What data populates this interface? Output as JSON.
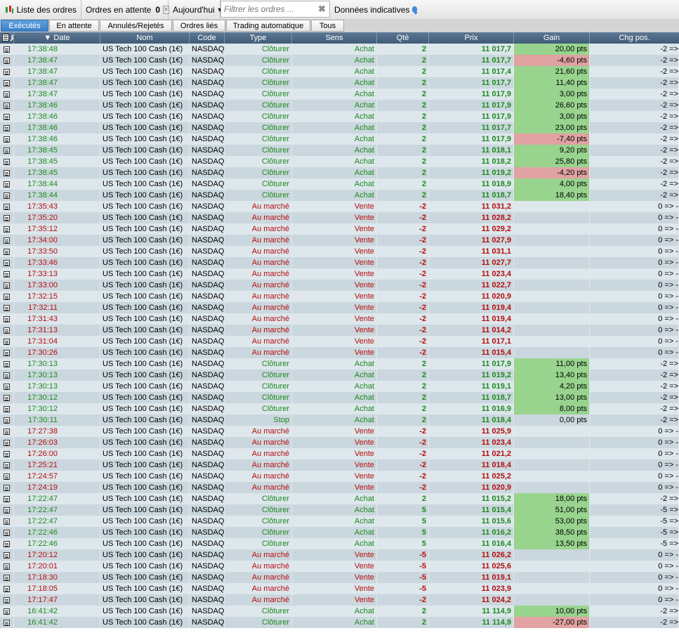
{
  "toolbar": {
    "order_list": "Liste des ordres",
    "pending_label": "Ordres en attente",
    "pending_count": "0",
    "period": "Aujourd'hui",
    "filter_placeholder": "Filtrer les ordres ...",
    "indicative": "Données indicatives"
  },
  "tabs": [
    "Exécutés",
    "En attente",
    "Annulés/Rejetés",
    "Ordres liés",
    "Trading automatique",
    "Tous"
  ],
  "active_tab": "Exécutés",
  "columns": [
    "Date",
    "Nom",
    "Code",
    "Type",
    "Sens",
    "Qté",
    "Prix",
    "Gain",
    "Chg pos."
  ],
  "sorted_column": "Date",
  "colors": {
    "buy": "#1d8a1d",
    "sell": "#b50d0d",
    "gain_positive": "#98d48e",
    "gain_negative": "#e1a2a2",
    "header": "#4a6683",
    "active_tab": "#3c7fc6"
  },
  "rows": [
    [
      "17:38:48",
      "US Tech 100 Cash (1€)",
      "NASDAQ",
      "Clôturer",
      "Achat",
      "2",
      "11 017,7",
      "20,00 pts",
      "-2 =>"
    ],
    [
      "17:38:47",
      "US Tech 100 Cash (1€)",
      "NASDAQ",
      "Clôturer",
      "Achat",
      "2",
      "11 017,7",
      "-4,60 pts",
      "-2 =>"
    ],
    [
      "17:38:47",
      "US Tech 100 Cash (1€)",
      "NASDAQ",
      "Clôturer",
      "Achat",
      "2",
      "11 017,4",
      "21,60 pts",
      "-2 =>"
    ],
    [
      "17:38:47",
      "US Tech 100 Cash (1€)",
      "NASDAQ",
      "Clôturer",
      "Achat",
      "2",
      "11 017,7",
      "11,40 pts",
      "-2 =>"
    ],
    [
      "17:38:47",
      "US Tech 100 Cash (1€)",
      "NASDAQ",
      "Clôturer",
      "Achat",
      "2",
      "11 017,9",
      "3,00 pts",
      "-2 =>"
    ],
    [
      "17:38:46",
      "US Tech 100 Cash (1€)",
      "NASDAQ",
      "Clôturer",
      "Achat",
      "2",
      "11 017,9",
      "26,60 pts",
      "-2 =>"
    ],
    [
      "17:38:46",
      "US Tech 100 Cash (1€)",
      "NASDAQ",
      "Clôturer",
      "Achat",
      "2",
      "11 017,9",
      "3,00 pts",
      "-2 =>"
    ],
    [
      "17:38:46",
      "US Tech 100 Cash (1€)",
      "NASDAQ",
      "Clôturer",
      "Achat",
      "2",
      "11 017,7",
      "23,00 pts",
      "-2 =>"
    ],
    [
      "17:38:46",
      "US Tech 100 Cash (1€)",
      "NASDAQ",
      "Clôturer",
      "Achat",
      "2",
      "11 017,9",
      "-7,40 pts",
      "-2 =>"
    ],
    [
      "17:38:45",
      "US Tech 100 Cash (1€)",
      "NASDAQ",
      "Clôturer",
      "Achat",
      "2",
      "11 018,1",
      "9,20 pts",
      "-2 =>"
    ],
    [
      "17:38:45",
      "US Tech 100 Cash (1€)",
      "NASDAQ",
      "Clôturer",
      "Achat",
      "2",
      "11 018,2",
      "25,80 pts",
      "-2 =>"
    ],
    [
      "17:38:45",
      "US Tech 100 Cash (1€)",
      "NASDAQ",
      "Clôturer",
      "Achat",
      "2",
      "11 019,2",
      "-4,20 pts",
      "-2 =>"
    ],
    [
      "17:38:44",
      "US Tech 100 Cash (1€)",
      "NASDAQ",
      "Clôturer",
      "Achat",
      "2",
      "11 018,9",
      "4,00 pts",
      "-2 =>"
    ],
    [
      "17:38:44",
      "US Tech 100 Cash (1€)",
      "NASDAQ",
      "Clôturer",
      "Achat",
      "2",
      "11 018,7",
      "18,40 pts",
      "-2 =>"
    ],
    [
      "17:35:43",
      "US Tech 100 Cash (1€)",
      "NASDAQ",
      "Au marché",
      "Vente",
      "-2",
      "11 031,2",
      "",
      "0 => -"
    ],
    [
      "17:35:20",
      "US Tech 100 Cash (1€)",
      "NASDAQ",
      "Au marché",
      "Vente",
      "-2",
      "11 028,2",
      "",
      "0 => -"
    ],
    [
      "17:35:12",
      "US Tech 100 Cash (1€)",
      "NASDAQ",
      "Au marché",
      "Vente",
      "-2",
      "11 029,2",
      "",
      "0 => -"
    ],
    [
      "17:34:00",
      "US Tech 100 Cash (1€)",
      "NASDAQ",
      "Au marché",
      "Vente",
      "-2",
      "11 027,9",
      "",
      "0 => -"
    ],
    [
      "17:33:50",
      "US Tech 100 Cash (1€)",
      "NASDAQ",
      "Au marché",
      "Vente",
      "-2",
      "11 031,1",
      "",
      "0 => -"
    ],
    [
      "17:33:46",
      "US Tech 100 Cash (1€)",
      "NASDAQ",
      "Au marché",
      "Vente",
      "-2",
      "11 027,7",
      "",
      "0 => -"
    ],
    [
      "17:33:13",
      "US Tech 100 Cash (1€)",
      "NASDAQ",
      "Au marché",
      "Vente",
      "-2",
      "11 023,4",
      "",
      "0 => -"
    ],
    [
      "17:33:00",
      "US Tech 100 Cash (1€)",
      "NASDAQ",
      "Au marché",
      "Vente",
      "-2",
      "11 022,7",
      "",
      "0 => -"
    ],
    [
      "17:32:15",
      "US Tech 100 Cash (1€)",
      "NASDAQ",
      "Au marché",
      "Vente",
      "-2",
      "11 020,9",
      "",
      "0 => -"
    ],
    [
      "17:32:11",
      "US Tech 100 Cash (1€)",
      "NASDAQ",
      "Au marché",
      "Vente",
      "-2",
      "11 019,4",
      "",
      "0 => -"
    ],
    [
      "17:31:43",
      "US Tech 100 Cash (1€)",
      "NASDAQ",
      "Au marché",
      "Vente",
      "-2",
      "11 019,4",
      "",
      "0 => -"
    ],
    [
      "17:31:13",
      "US Tech 100 Cash (1€)",
      "NASDAQ",
      "Au marché",
      "Vente",
      "-2",
      "11 014,2",
      "",
      "0 => -"
    ],
    [
      "17:31:04",
      "US Tech 100 Cash (1€)",
      "NASDAQ",
      "Au marché",
      "Vente",
      "-2",
      "11 017,1",
      "",
      "0 => -"
    ],
    [
      "17:30:26",
      "US Tech 100 Cash (1€)",
      "NASDAQ",
      "Au marché",
      "Vente",
      "-2",
      "11 015,4",
      "",
      "0 => -"
    ],
    [
      "17:30:13",
      "US Tech 100 Cash (1€)",
      "NASDAQ",
      "Clôturer",
      "Achat",
      "2",
      "11 017,9",
      "11,00 pts",
      "-2 =>"
    ],
    [
      "17:30:13",
      "US Tech 100 Cash (1€)",
      "NASDAQ",
      "Clôturer",
      "Achat",
      "2",
      "11 019,2",
      "13,40 pts",
      "-2 =>"
    ],
    [
      "17:30:13",
      "US Tech 100 Cash (1€)",
      "NASDAQ",
      "Clôturer",
      "Achat",
      "2",
      "11 019,1",
      "4,20 pts",
      "-2 =>"
    ],
    [
      "17:30:12",
      "US Tech 100 Cash (1€)",
      "NASDAQ",
      "Clôturer",
      "Achat",
      "2",
      "11 018,7",
      "13,00 pts",
      "-2 =>"
    ],
    [
      "17:30:12",
      "US Tech 100 Cash (1€)",
      "NASDAQ",
      "Clôturer",
      "Achat",
      "2",
      "11 016,9",
      "8,00 pts",
      "-2 =>"
    ],
    [
      "17:30:11",
      "US Tech 100 Cash (1€)",
      "NASDAQ",
      "Stop",
      "Achat",
      "2",
      "11 018,4",
      "0,00 pts",
      "-2 =>"
    ],
    [
      "17:27:38",
      "US Tech 100 Cash (1€)",
      "NASDAQ",
      "Au marché",
      "Vente",
      "-2",
      "11 025,9",
      "",
      "0 => -"
    ],
    [
      "17:26:03",
      "US Tech 100 Cash (1€)",
      "NASDAQ",
      "Au marché",
      "Vente",
      "-2",
      "11 023,4",
      "",
      "0 => -"
    ],
    [
      "17:26:00",
      "US Tech 100 Cash (1€)",
      "NASDAQ",
      "Au marché",
      "Vente",
      "-2",
      "11 021,2",
      "",
      "0 => -"
    ],
    [
      "17:25:21",
      "US Tech 100 Cash (1€)",
      "NASDAQ",
      "Au marché",
      "Vente",
      "-2",
      "11 018,4",
      "",
      "0 => -"
    ],
    [
      "17:24:57",
      "US Tech 100 Cash (1€)",
      "NASDAQ",
      "Au marché",
      "Vente",
      "-2",
      "11 025,2",
      "",
      "0 => -"
    ],
    [
      "17:24:19",
      "US Tech 100 Cash (1€)",
      "NASDAQ",
      "Au marché",
      "Vente",
      "-2",
      "11 020,9",
      "",
      "0 => -"
    ],
    [
      "17:22:47",
      "US Tech 100 Cash (1€)",
      "NASDAQ",
      "Clôturer",
      "Achat",
      "2",
      "11 015,2",
      "18,00 pts",
      "-2 =>"
    ],
    [
      "17:22:47",
      "US Tech 100 Cash (1€)",
      "NASDAQ",
      "Clôturer",
      "Achat",
      "5",
      "11 015,4",
      "51,00 pts",
      "-5 =>"
    ],
    [
      "17:22:47",
      "US Tech 100 Cash (1€)",
      "NASDAQ",
      "Clôturer",
      "Achat",
      "5",
      "11 015,6",
      "53,00 pts",
      "-5 =>"
    ],
    [
      "17:22:46",
      "US Tech 100 Cash (1€)",
      "NASDAQ",
      "Clôturer",
      "Achat",
      "5",
      "11 016,2",
      "38,50 pts",
      "-5 =>"
    ],
    [
      "17:22:46",
      "US Tech 100 Cash (1€)",
      "NASDAQ",
      "Clôturer",
      "Achat",
      "5",
      "11 016,4",
      "13,50 pts",
      "-5 =>"
    ],
    [
      "17:20:12",
      "US Tech 100 Cash (1€)",
      "NASDAQ",
      "Au marché",
      "Vente",
      "-5",
      "11 026,2",
      "",
      "0 => -"
    ],
    [
      "17:20:01",
      "US Tech 100 Cash (1€)",
      "NASDAQ",
      "Au marché",
      "Vente",
      "-5",
      "11 025,6",
      "",
      "0 => -"
    ],
    [
      "17:18:30",
      "US Tech 100 Cash (1€)",
      "NASDAQ",
      "Au marché",
      "Vente",
      "-5",
      "11 019,1",
      "",
      "0 => -"
    ],
    [
      "17:18:05",
      "US Tech 100 Cash (1€)",
      "NASDAQ",
      "Au marché",
      "Vente",
      "-5",
      "11 023,9",
      "",
      "0 => -"
    ],
    [
      "17:17:47",
      "US Tech 100 Cash (1€)",
      "NASDAQ",
      "Au marché",
      "Vente",
      "-2",
      "11 024,2",
      "",
      "0 => -"
    ],
    [
      "16:41:42",
      "US Tech 100 Cash (1€)",
      "NASDAQ",
      "Clôturer",
      "Achat",
      "2",
      "11 114,9",
      "10,00 pts",
      "-2 =>"
    ],
    [
      "16:41:42",
      "US Tech 100 Cash (1€)",
      "NASDAQ",
      "Clôturer",
      "Achat",
      "2",
      "11 114,9",
      "-27,00 pts",
      "-2 =>"
    ]
  ]
}
